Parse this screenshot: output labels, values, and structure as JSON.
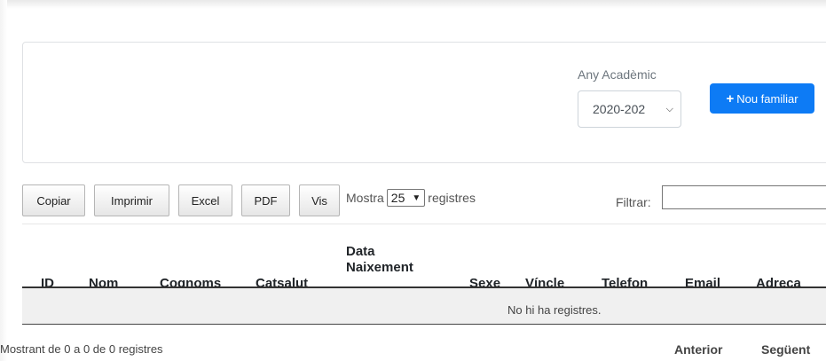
{
  "filters": {
    "year_label": "Any Acadèmic",
    "year_value": "2020-202"
  },
  "actions": {
    "new_family": "Nou familiar"
  },
  "export_buttons": [
    "Copiar",
    "Imprimir",
    "Excel",
    "PDF",
    "Vis"
  ],
  "length": {
    "prefix": "Mostra",
    "value": "25",
    "suffix": "registres"
  },
  "search": {
    "label": "Filtrar:",
    "value": ""
  },
  "table": {
    "columns": [
      "ID",
      "Nom",
      "Cognoms",
      "Catsalut",
      "Data Naixement",
      "Sexe",
      "Víncle",
      "Telefon",
      "Email",
      "Adreça"
    ],
    "empty_message": "No hi ha registres."
  },
  "footer": {
    "info": "Mostrant de 0 a 0 de 0 registres",
    "previous": "Anterior",
    "next": "Següent"
  },
  "colors": {
    "primary": "#0d7bf5"
  }
}
